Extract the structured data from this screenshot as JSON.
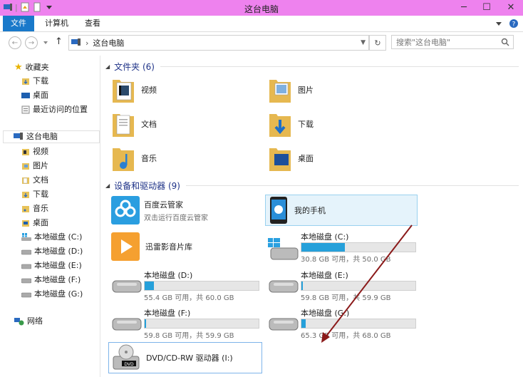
{
  "window": {
    "title": "这台电脑"
  },
  "ribbon": {
    "tabs": [
      "文件",
      "计算机",
      "查看"
    ]
  },
  "address": {
    "path": "这台电脑",
    "search_placeholder": "搜索\"这台电脑\""
  },
  "sidebar": {
    "favorites": {
      "label": "收藏夹",
      "items": [
        "下载",
        "桌面",
        "最近访问的位置"
      ]
    },
    "computer": {
      "label": "这台电脑",
      "items": [
        "视频",
        "图片",
        "文档",
        "下载",
        "音乐",
        "桌面",
        "本地磁盘 (C:)",
        "本地磁盘 (D:)",
        "本地磁盘 (E:)",
        "本地磁盘 (F:)",
        "本地磁盘 (G:)"
      ]
    },
    "network": {
      "label": "网络"
    }
  },
  "folders": {
    "header": "文件夹 (6)",
    "items": [
      "视频",
      "图片",
      "文档",
      "下载",
      "音乐",
      "桌面"
    ]
  },
  "devices": {
    "header": "设备和驱动器 (9)",
    "apps": [
      {
        "name": "百度云管家",
        "sub": "双击运行百度云管家"
      },
      {
        "name": "我的手机"
      },
      {
        "name": "迅雷影音片库"
      }
    ],
    "drives": [
      {
        "name": "本地磁盘 (C:)",
        "cap": "30.8 GB 可用，共 50.0 GB",
        "used_fraction": 0.38
      },
      {
        "name": "本地磁盘 (D:)",
        "cap": "55.4 GB 可用，共 60.0 GB",
        "used_fraction": 0.08
      },
      {
        "name": "本地磁盘 (E:)",
        "cap": "59.8 GB 可用，共 59.9 GB",
        "used_fraction": 0.01
      },
      {
        "name": "本地磁盘 (F:)",
        "cap": "59.8 GB 可用，共 59.9 GB",
        "used_fraction": 0.01
      },
      {
        "name": "本地磁盘 (G:)",
        "cap": "65.3 GB 可用，共 68.0 GB",
        "used_fraction": 0.04
      }
    ],
    "dvd": {
      "name": "DVD/CD-RW 驱动器 (I:)",
      "badge": "DVD"
    }
  },
  "colors": {
    "title_bg": "#ee82ee",
    "file_tab": "#1979ca",
    "section_text": "#1e3287",
    "bar_fill": "#26a0da",
    "arrow": "#8b1a1a"
  }
}
